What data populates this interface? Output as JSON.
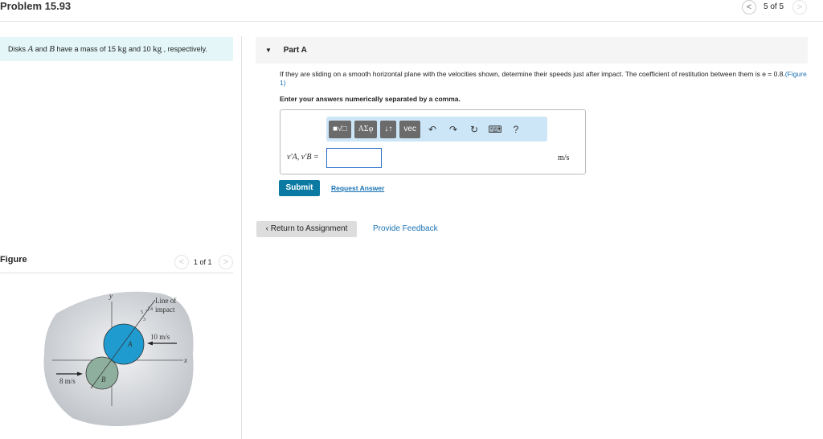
{
  "header": {
    "title": "Problem 15.93",
    "position": "5 of 5"
  },
  "intro": {
    "pre": "Disks ",
    "a": "A",
    "mid1": " and ",
    "b": "B",
    "mid2": " have a mass of 15 ",
    "kg1": "kg",
    "mid3": " and 10 ",
    "kg2": "kg",
    "post": " , respectively."
  },
  "part": {
    "label": "Part A",
    "question": "If they are sliding on a smooth horizontal plane with the velocities shown, determine their speeds just after impact. The coefficient of restitution between them is e = 0.8.",
    "figure_link": "(Figure 1)",
    "instruction": "Enter your answers numerically separated by a comma.",
    "toolbar": {
      "templates": "■√□",
      "greek": "ΑΣφ",
      "arrows": "↓↑",
      "vec": "vec",
      "help": "?"
    },
    "answer_label": "v′A, v′B =",
    "answer_value": "",
    "units": "m/s",
    "submit": "Submit",
    "request_answer": "Request Answer"
  },
  "footer": {
    "return": "Return to Assignment",
    "feedback": "Provide Feedback"
  },
  "figure": {
    "heading": "Figure",
    "position": "1 of 1",
    "labels": {
      "y": "y",
      "x": "x",
      "line1": "Line of",
      "line2": "impact",
      "five": "5",
      "four": "4",
      "three": "3",
      "vA": "10 m/s",
      "vB": "8 m/s",
      "A": "A",
      "B": "B"
    }
  }
}
